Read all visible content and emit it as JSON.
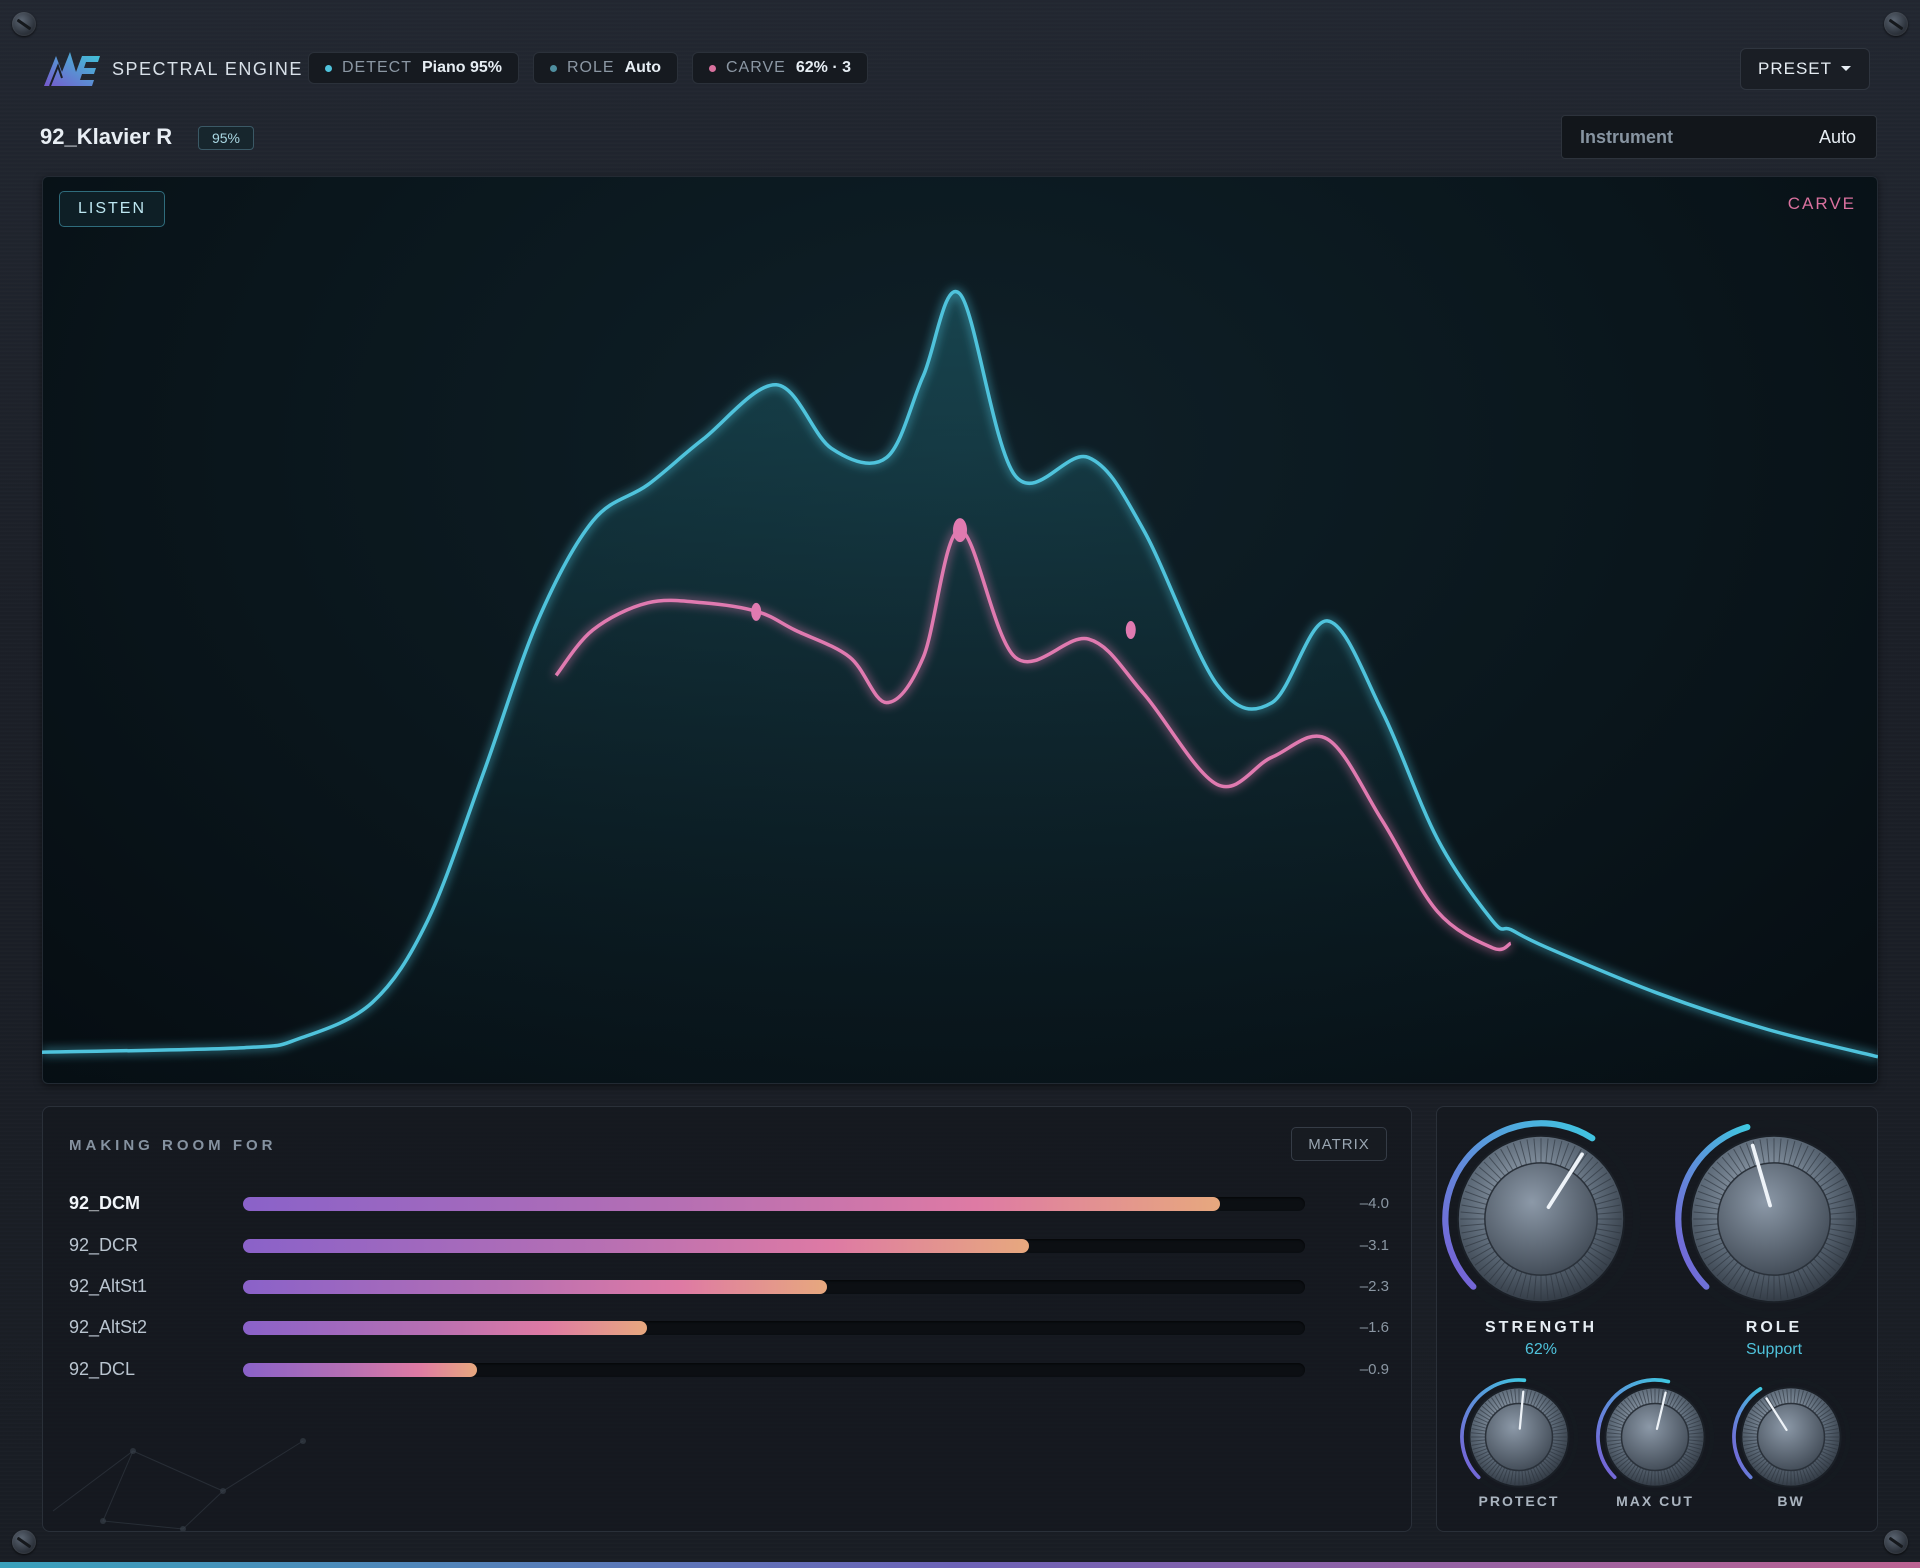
{
  "app": {
    "name": "SPECTRAL ENGINE",
    "logo_icon": "spectral-engine-logo-icon"
  },
  "status": {
    "detect": {
      "label": "DETECT",
      "value": "Piano 95%",
      "color": "#4fc3dc"
    },
    "role": {
      "label": "ROLE",
      "value": "Auto",
      "color": "#4f8fa0"
    },
    "carve": {
      "label": "CARVE",
      "value": "62% · 3",
      "color": "#d9719e"
    }
  },
  "preset": {
    "label": "PRESET",
    "icon": "caret-down-icon"
  },
  "track": {
    "title": "92_Klavier R",
    "confidence": "95%"
  },
  "instrument": {
    "label": "Instrument",
    "value": "Auto"
  },
  "spectrum": {
    "listen_label": "LISTEN",
    "carve_label": "CARVE",
    "colors": {
      "input": "#4fc3dc",
      "carved": "#e07ab0"
    }
  },
  "chart_data": {
    "type": "line",
    "x_range": [
      0,
      1
    ],
    "y_range": [
      0,
      1
    ],
    "series": [
      {
        "points": [
          [
            0,
            0.035
          ],
          [
            0.11,
            0.04
          ],
          [
            0.14,
            0.05
          ],
          [
            0.18,
            0.09
          ],
          [
            0.21,
            0.18
          ],
          [
            0.24,
            0.34
          ],
          [
            0.27,
            0.51
          ],
          [
            0.3,
            0.62
          ],
          [
            0.33,
            0.66
          ],
          [
            0.36,
            0.71
          ],
          [
            0.4,
            0.77
          ],
          [
            0.43,
            0.7
          ],
          [
            0.46,
            0.69
          ],
          [
            0.48,
            0.78
          ],
          [
            0.5,
            0.87
          ],
          [
            0.53,
            0.67
          ],
          [
            0.57,
            0.69
          ],
          [
            0.6,
            0.61
          ],
          [
            0.64,
            0.44
          ],
          [
            0.67,
            0.42
          ],
          [
            0.7,
            0.51
          ],
          [
            0.73,
            0.41
          ],
          [
            0.76,
            0.27
          ],
          [
            0.79,
            0.18
          ],
          [
            0.8,
            0.17
          ],
          [
            0.82,
            0.15
          ],
          [
            0.88,
            0.1
          ],
          [
            0.94,
            0.06
          ],
          [
            1,
            0.03
          ]
        ],
        "peaks": [
          [
            0.4,
            0.77
          ],
          [
            0.5,
            0.87
          ],
          [
            0.595,
            0.72
          ],
          [
            0.7,
            0.51
          ]
        ]
      },
      {
        "points": [
          [
            0.28,
            0.45
          ],
          [
            0.3,
            0.5
          ],
          [
            0.33,
            0.53
          ],
          [
            0.36,
            0.53
          ],
          [
            0.39,
            0.52
          ],
          [
            0.41,
            0.5
          ],
          [
            0.44,
            0.47
          ],
          [
            0.46,
            0.42
          ],
          [
            0.48,
            0.47
          ],
          [
            0.5,
            0.61
          ],
          [
            0.53,
            0.47
          ],
          [
            0.57,
            0.49
          ],
          [
            0.6,
            0.43
          ],
          [
            0.64,
            0.33
          ],
          [
            0.67,
            0.36
          ],
          [
            0.7,
            0.38
          ],
          [
            0.73,
            0.29
          ],
          [
            0.76,
            0.19
          ],
          [
            0.79,
            0.15
          ],
          [
            0.8,
            0.155
          ]
        ],
        "markers": [
          [
            0.389,
            0.52
          ],
          [
            0.5,
            0.61
          ],
          [
            0.593,
            0.5
          ]
        ]
      }
    ]
  },
  "making_room": {
    "title": "MAKING ROOM FOR",
    "matrix_label": "MATRIX",
    "items": [
      {
        "name": "92_DCM",
        "amount": 0.92,
        "value": "–4.0",
        "active": true
      },
      {
        "name": "92_DCR",
        "amount": 0.74,
        "value": "–3.1",
        "active": false
      },
      {
        "name": "92_AltSt1",
        "amount": 0.55,
        "value": "–2.3",
        "active": false
      },
      {
        "name": "92_AltSt2",
        "amount": 0.38,
        "value": "–1.6",
        "active": false
      },
      {
        "name": "92_DCL",
        "amount": 0.22,
        "value": "–0.9",
        "active": false
      }
    ]
  },
  "controls": {
    "strength": {
      "label": "STRENGTH",
      "value": "62%",
      "amount": 0.62
    },
    "role": {
      "label": "ROLE",
      "value": "Support",
      "amount": 0.44
    },
    "protect": {
      "label": "PROTECT",
      "amount": 0.52
    },
    "max_cut": {
      "label": "MAX CUT",
      "amount": 0.55
    },
    "bw": {
      "label": "BW",
      "amount": 0.38
    }
  }
}
